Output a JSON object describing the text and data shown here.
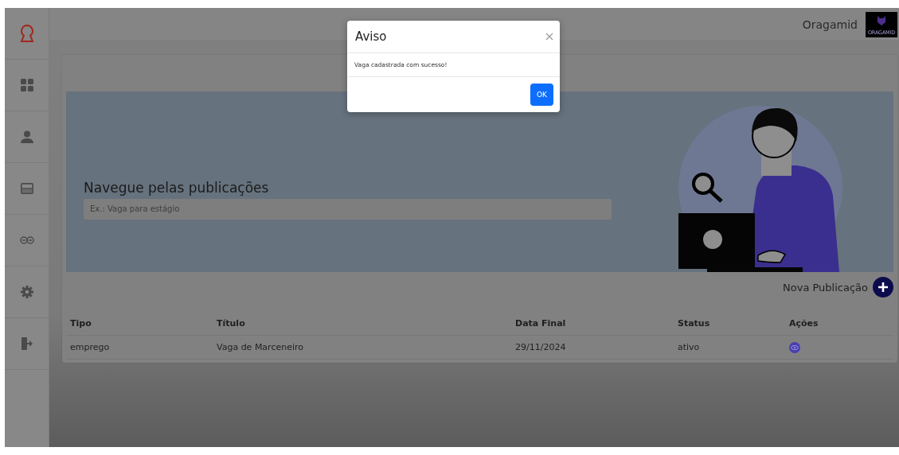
{
  "topbar": {
    "user_name": "Oragamid",
    "logo_text": "ORAGAMID"
  },
  "banner": {
    "title": "Navegue pelas publicações",
    "search": {
      "placeholder": "Ex.: Vaga para estágio"
    }
  },
  "new_publication": {
    "label": "Nova Publicação"
  },
  "table": {
    "columns": [
      "Tipo",
      "Título",
      "Data Final",
      "Status",
      "Ações"
    ],
    "rows": [
      {
        "cells": [
          "emprego",
          "Vaga de Marceneiro",
          "29/11/2024",
          "ativo"
        ]
      }
    ]
  },
  "modal": {
    "title": "Aviso",
    "message": "Vaga cadastrada com sucesso!",
    "button": "OK"
  }
}
